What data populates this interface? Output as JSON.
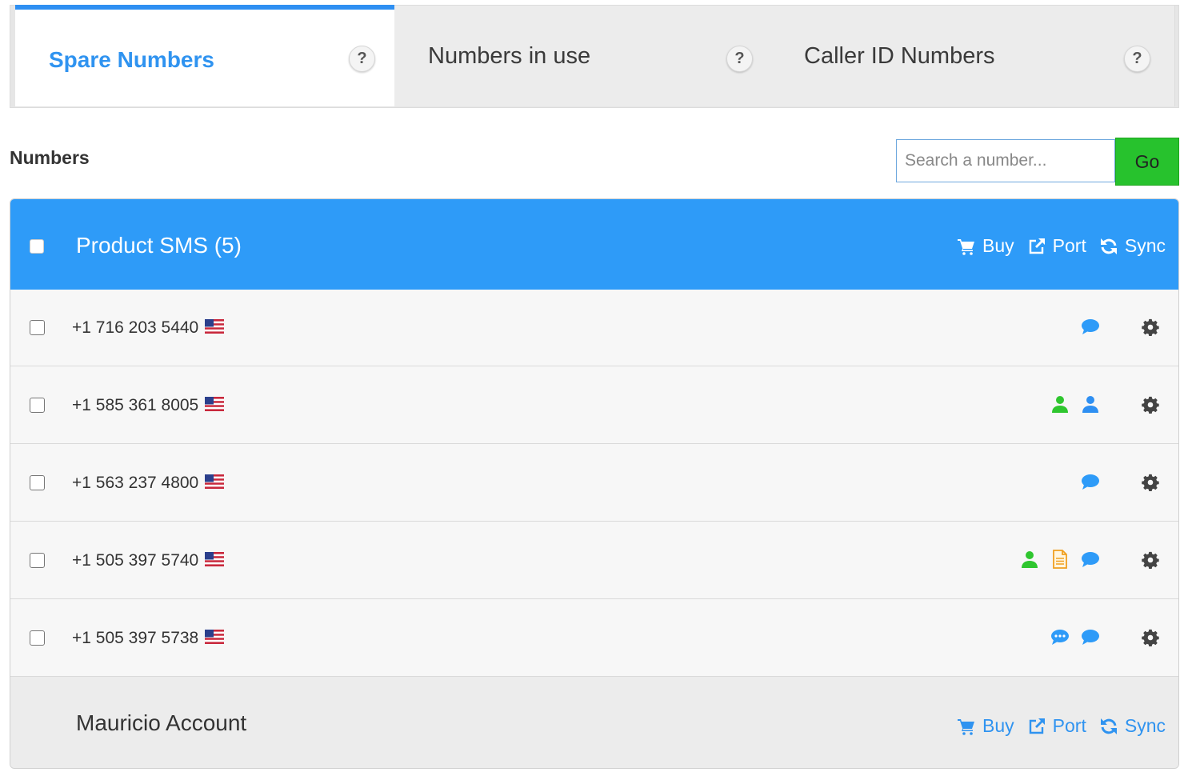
{
  "tabs": [
    {
      "label": "Spare Numbers",
      "help": "?"
    },
    {
      "label": "Numbers in use",
      "help": "?"
    },
    {
      "label": "Caller ID Numbers",
      "help": "?"
    }
  ],
  "section": {
    "title": "Numbers"
  },
  "search": {
    "placeholder": "Search a number...",
    "go_label": "Go"
  },
  "groups": [
    {
      "title": "Product SMS   (5)",
      "actions": {
        "buy": "Buy",
        "port": "Port",
        "sync": "Sync"
      },
      "numbers": [
        {
          "number": "+1 716 203 5440",
          "flag": "us-flag-icon",
          "icons": [
            "sms-icon"
          ]
        },
        {
          "number": "+1 585 361 8005",
          "flag": "us-flag-icon",
          "icons": [
            "user-green-icon",
            "user-blue-icon"
          ]
        },
        {
          "number": "+1 563 237 4800",
          "flag": "us-flag-icon",
          "icons": [
            "sms-icon"
          ]
        },
        {
          "number": "+1 505 397 5740",
          "flag": "us-flag-icon",
          "icons": [
            "user-green-icon",
            "document-icon",
            "sms-icon"
          ]
        },
        {
          "number": "+1 505 397 5738",
          "flag": "us-flag-icon",
          "icons": [
            "chat-dots-icon",
            "sms-icon"
          ]
        }
      ]
    },
    {
      "title": "Mauricio Account",
      "actions": {
        "buy": "Buy",
        "port": "Port",
        "sync": "Sync"
      }
    }
  ],
  "colors": {
    "accent": "#2e9bf8",
    "go": "#27c22d",
    "green": "#2fc62f",
    "orange": "#f0a020"
  }
}
